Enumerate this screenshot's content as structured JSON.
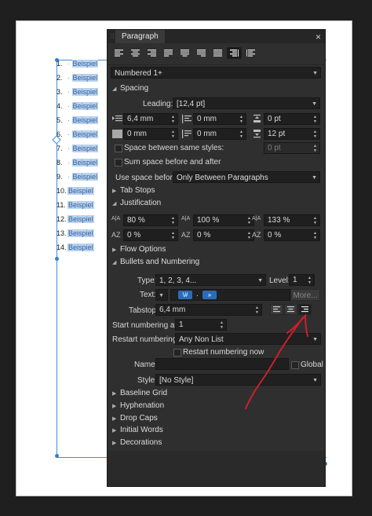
{
  "document": {
    "lines": [
      {
        "num": "1.",
        "word": "Beispiel"
      },
      {
        "num": "2.",
        "word": "Beispiel"
      },
      {
        "num": "3.",
        "word": "Beispiel"
      },
      {
        "num": "4.",
        "word": "Beispiel"
      },
      {
        "num": "5.",
        "word": "Beispiel"
      },
      {
        "num": "6.",
        "word": "Beispiel"
      },
      {
        "num": "7.",
        "word": "Beispiel"
      },
      {
        "num": "8.",
        "word": "Beispiel"
      },
      {
        "num": "9.",
        "word": "Beispiel"
      },
      {
        "num": "10.",
        "word": "Beispiel"
      },
      {
        "num": "11.",
        "word": "Beispiel"
      },
      {
        "num": "12.",
        "word": "Beispiel"
      },
      {
        "num": "13.",
        "word": "Beispiel"
      },
      {
        "num": "14.",
        "word": "Beispiel"
      }
    ],
    "selection_color": "#3e8ede"
  },
  "panel": {
    "title": "Paragraph",
    "close": "×",
    "style_select": "Numbered 1+",
    "sections": {
      "spacing": "Spacing",
      "tab_stops": "Tab Stops",
      "justification": "Justification",
      "flow_options": "Flow Options",
      "bullets": "Bullets and Numbering",
      "baseline_grid": "Baseline Grid",
      "hyphenation": "Hyphenation",
      "drop_caps": "Drop Caps",
      "initial_words": "Initial Words",
      "decorations": "Decorations"
    },
    "spacing": {
      "leading_label": "Leading:",
      "leading_value": "[12,4 pt]",
      "left_indent": "6,4 mm",
      "first_line_indent": "0 mm",
      "space_before": "0 pt",
      "right_indent": "0 mm",
      "last_line_indent": "0 mm",
      "space_after": "12 pt",
      "space_same_styles": "Space between same styles:",
      "space_same_value": "0 pt",
      "sum_space": "Sum space before and after",
      "use_space_before_label": "Use space before:",
      "use_space_before_value": "Only Between Paragraphs"
    },
    "justification": {
      "word_spacing": "80 %",
      "letter_spacing": "100 %",
      "glyph_scaling": "133 %",
      "word_spacing_min": "0 %",
      "letter_spacing_min": "0 %",
      "glyph_scaling_min": "0 %"
    },
    "bullets": {
      "type_label": "Type:",
      "type_value": "1, 2, 3, 4...",
      "level_label": "Level:",
      "level_value": "1",
      "text_label": "Text:",
      "text_token1": "\\#",
      "text_token2": ".",
      "text_token3": "»",
      "more_label": "More...",
      "tabstop_label": "Tabstop:",
      "tabstop_value": "6,4 mm",
      "start_label": "Start numbering at:",
      "start_value": "1",
      "restart_label": "Restart numbering:",
      "restart_value": "Any Non List",
      "restart_now": "Restart numbering now",
      "name_label": "Name:",
      "name_value": "",
      "global_label": "Global",
      "style_label": "Style:",
      "style_value": "[No Style]"
    },
    "annotation_color": "#cc1f2a"
  }
}
